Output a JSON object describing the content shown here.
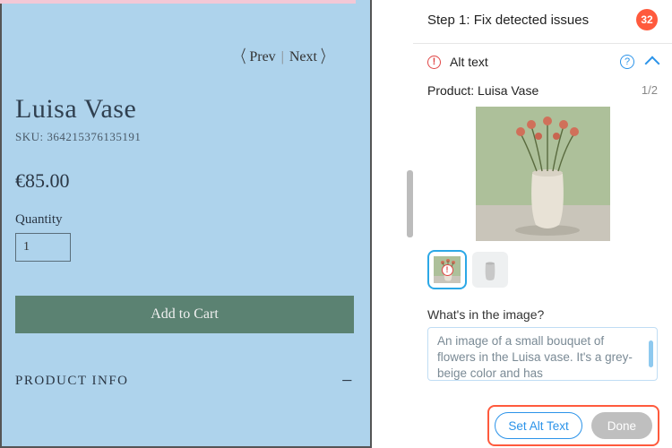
{
  "preview": {
    "prev": "Prev",
    "next": "Next",
    "title": "Luisa Vase",
    "sku_label": "SKU: 364215376135191",
    "price": "€85.00",
    "qty_label": "Quantity",
    "qty_value": "1",
    "add_to_cart": "Add to Cart",
    "accordion": "PRODUCT INFO"
  },
  "panel": {
    "step_title": "Step 1: Fix detected issues",
    "issue_count": "32",
    "section": "Alt text",
    "product_label": "Product: Luisa Vase",
    "counter": "1/2",
    "prompt": "What's in the image?",
    "alt_text": "An image of a small bouquet of flowers in the Luisa vase. It's a grey-beige color and has",
    "set_btn": "Set Alt Text",
    "done_btn": "Done"
  }
}
